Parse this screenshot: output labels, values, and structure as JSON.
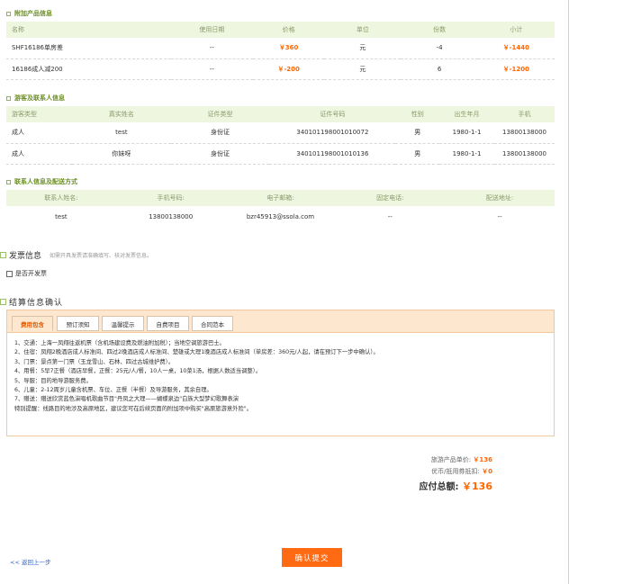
{
  "addon": {
    "title": "附加产品信息",
    "headers": [
      "名称",
      "使用日期",
      "价格",
      "单位",
      "份数",
      "小计"
    ],
    "rows": [
      [
        "SHF16186单房差",
        "--",
        "￥360",
        "元",
        "-4",
        "￥-1440"
      ],
      [
        "16186成人减200",
        "--",
        "￥-200",
        "元",
        "6",
        "￥-1200"
      ]
    ]
  },
  "travelers": {
    "title": "游客及联系人信息",
    "headers": [
      "游客类型",
      "真实姓名",
      "证件类型",
      "证件号码",
      "性别",
      "出生年月",
      "手机"
    ],
    "rows": [
      [
        "成人",
        "test",
        "身份证",
        "340101198001010072",
        "男",
        "1980-1-1",
        "13800138000"
      ],
      [
        "成人",
        "你妹呀",
        "身份证",
        "340101198001010136",
        "男",
        "1980-1-1",
        "13800138000"
      ]
    ]
  },
  "contact": {
    "title": "联系人信息及配送方式",
    "headers": [
      "联系人姓名:",
      "手机号码:",
      "电子邮箱:",
      "固定电话:",
      "配送地址:"
    ],
    "row": [
      "test",
      "13800138000",
      "bzr45913@ssola.com",
      "--",
      "--"
    ]
  },
  "invoice": {
    "title": "发票信息",
    "hint": "如需开具发票请准确填写、核对发票信息。",
    "option": "是否开发票"
  },
  "settlement": {
    "title": "结算信息确认",
    "tabs": [
      "费用包含",
      "预订须知",
      "温馨提示",
      "自费项目",
      "合同范本"
    ],
    "notes": [
      "1、交通：上海一凤翔往返机票（含机场建设费及燃油附加税）；当地空调旅游巴士。",
      "2、住宿：凤翔2晚酒店成人标准间、四过2晚酒店成人标准间、楚雄或大理1晚酒店成人标准间（单房差：360元/人起，请在预订下一步中确认）。",
      "3、门票：景点第一门票（玉龙雪山、石林、四过古城维护费）。",
      "4、用餐：5早7正餐（酒店早餐，正餐：25元/人/餐，10人一桌，10菜1汤，根据人数适当调整）。",
      "5、导服：目的地导游服务费。",
      "6、儿童：2-12周岁儿童含机票、车位、正餐（半餐）及导游服务，其余自理。",
      "7、赠送：赠送欣赏蓝色演唱机歌曲节目\"丹凤之大理——蝴蝶泉边\"白族大型梦幻歌舞表演",
      "特别提醒：线路目的地涉及高原地区，建议您可在后续页面的附加项中购买\"高原旅游意外险\"。"
    ]
  },
  "summary": {
    "unit_label": "旅游产品单价:",
    "unit_value": "￥136",
    "coupon_label": "优币/抵用券抵扣:",
    "coupon_value": "￥0",
    "total_label": "应付总额:",
    "total_value": "￥136"
  },
  "nav": {
    "back": "<< 返回上一步",
    "submit": "确认提交"
  }
}
